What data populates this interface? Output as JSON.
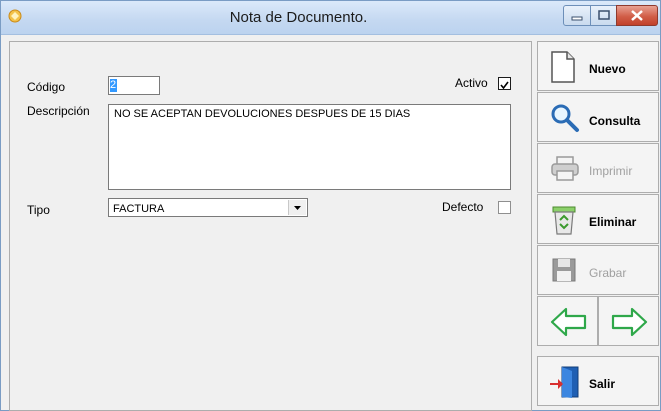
{
  "window": {
    "title": "Nota de Documento."
  },
  "form": {
    "codigo_label": "Código",
    "codigo_value": "2",
    "activo_label": "Activo",
    "activo_checked": true,
    "descripcion_label": "Descripción",
    "descripcion_value": "NO SE ACEPTAN DEVOLUCIONES DESPUES DE 15 DIAS",
    "tipo_label": "Tipo",
    "tipo_value": "FACTURA",
    "defecto_label": "Defecto",
    "defecto_checked": false
  },
  "sidebar": {
    "nuevo": "Nuevo",
    "consulta": "Consulta",
    "imprimir": "Imprimir",
    "eliminar": "Eliminar",
    "grabar": "Grabar",
    "salir": "Salir"
  },
  "icons": {
    "app": "app-icon",
    "nuevo": "document-icon",
    "consulta": "magnifier-icon",
    "imprimir": "printer-icon",
    "eliminar": "recycle-bin-icon",
    "grabar": "floppy-disk-icon",
    "prev": "arrow-left-icon",
    "next": "arrow-right-icon",
    "salir": "exit-door-icon"
  },
  "colors": {
    "nav_arrow": "#2fa84a",
    "selection": "#3399ff",
    "close_button": "#c1402a"
  }
}
